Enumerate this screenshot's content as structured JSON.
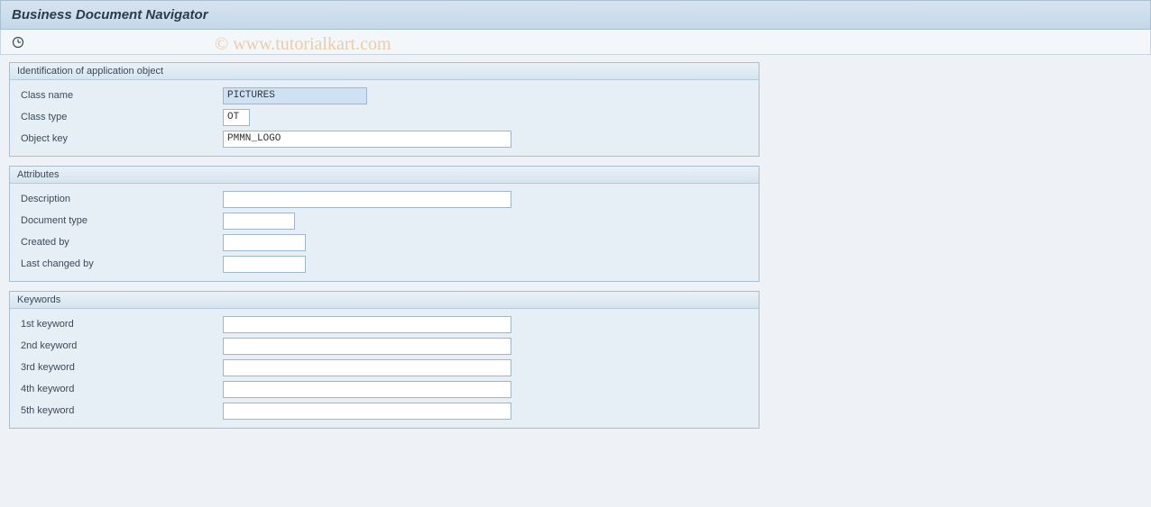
{
  "title": "Business Document Navigator",
  "watermark": "© www.tutorialkart.com",
  "groups": {
    "identification": {
      "title": "Identification of application object",
      "fields": {
        "class_name": {
          "label": "Class name",
          "value": "PICTURES"
        },
        "class_type": {
          "label": "Class type",
          "value": "OT"
        },
        "object_key": {
          "label": "Object key",
          "value": "PMMN_LOGO"
        }
      }
    },
    "attributes": {
      "title": "Attributes",
      "fields": {
        "description": {
          "label": "Description",
          "value": ""
        },
        "document_type": {
          "label": "Document type",
          "value": ""
        },
        "created_by": {
          "label": "Created by",
          "value": ""
        },
        "last_changed_by": {
          "label": "Last changed by",
          "value": ""
        }
      }
    },
    "keywords": {
      "title": "Keywords",
      "fields": {
        "kw1": {
          "label": "1st keyword",
          "value": ""
        },
        "kw2": {
          "label": "2nd keyword",
          "value": ""
        },
        "kw3": {
          "label": "3rd keyword",
          "value": ""
        },
        "kw4": {
          "label": "4th keyword",
          "value": ""
        },
        "kw5": {
          "label": "5th keyword",
          "value": ""
        }
      }
    }
  }
}
